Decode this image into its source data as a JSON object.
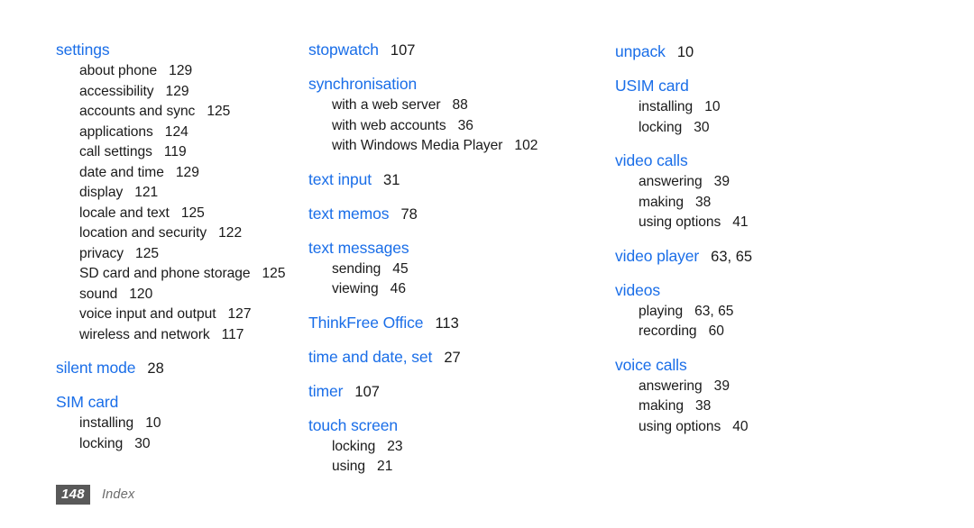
{
  "document": {
    "section_title": "Index",
    "page_number": "148",
    "heading_color": "#1a6ee8",
    "text_color": "#1a1a1a",
    "badge_color": "#595959",
    "background_color": "#ffffff"
  },
  "columns": [
    {
      "name": "column-1",
      "groups": [
        {
          "heading": "settings",
          "pages": "",
          "subentries": [
            {
              "label": "about phone",
              "pages": "129"
            },
            {
              "label": "accessibility",
              "pages": "129"
            },
            {
              "label": "accounts and sync",
              "pages": "125"
            },
            {
              "label": "applications",
              "pages": "124"
            },
            {
              "label": "call settings",
              "pages": "119"
            },
            {
              "label": "date and time",
              "pages": "129"
            },
            {
              "label": "display",
              "pages": "121"
            },
            {
              "label": "locale and text",
              "pages": "125"
            },
            {
              "label": "location and security",
              "pages": "122"
            },
            {
              "label": "privacy",
              "pages": "125"
            },
            {
              "label": "SD card and phone storage",
              "pages": "125"
            },
            {
              "label": "sound",
              "pages": "120"
            },
            {
              "label": "voice input and output",
              "pages": "127"
            },
            {
              "label": "wireless and network",
              "pages": "117"
            }
          ]
        },
        {
          "heading": "silent mode",
          "pages": "28",
          "subentries": []
        },
        {
          "heading": "SIM card",
          "pages": "",
          "subentries": [
            {
              "label": "installing",
              "pages": "10"
            },
            {
              "label": "locking",
              "pages": "30"
            }
          ]
        }
      ]
    },
    {
      "name": "column-2",
      "groups": [
        {
          "heading": "stopwatch",
          "pages": "107",
          "subentries": []
        },
        {
          "heading": "synchronisation",
          "pages": "",
          "subentries": [
            {
              "label": "with a web server",
              "pages": "88"
            },
            {
              "label": "with web accounts",
              "pages": "36"
            },
            {
              "label": "with Windows Media Player",
              "pages": "102"
            }
          ]
        },
        {
          "heading": "text input",
          "pages": "31",
          "subentries": []
        },
        {
          "heading": "text memos",
          "pages": "78",
          "subentries": []
        },
        {
          "heading": "text messages",
          "pages": "",
          "subentries": [
            {
              "label": "sending",
              "pages": "45"
            },
            {
              "label": "viewing",
              "pages": "46"
            }
          ]
        },
        {
          "heading": "ThinkFree Office",
          "pages": "113",
          "subentries": []
        },
        {
          "heading": "time and date, set",
          "pages": "27",
          "subentries": []
        },
        {
          "heading": "timer",
          "pages": "107",
          "subentries": []
        },
        {
          "heading": "touch screen",
          "pages": "",
          "subentries": [
            {
              "label": "locking",
              "pages": "23"
            },
            {
              "label": "using",
              "pages": "21"
            }
          ]
        }
      ]
    },
    {
      "name": "column-3",
      "groups": [
        {
          "heading": "unpack",
          "pages": "10",
          "subentries": []
        },
        {
          "heading": "USIM card",
          "pages": "",
          "subentries": [
            {
              "label": "installing",
              "pages": "10"
            },
            {
              "label": "locking",
              "pages": "30"
            }
          ]
        },
        {
          "heading": "video calls",
          "pages": "",
          "subentries": [
            {
              "label": "answering",
              "pages": "39"
            },
            {
              "label": "making",
              "pages": "38"
            },
            {
              "label": "using options",
              "pages": "41"
            }
          ]
        },
        {
          "heading": "video player",
          "pages": "63, 65",
          "subentries": []
        },
        {
          "heading": "videos",
          "pages": "",
          "subentries": [
            {
              "label": "playing",
              "pages": "63, 65"
            },
            {
              "label": "recording",
              "pages": "60"
            }
          ]
        },
        {
          "heading": "voice calls",
          "pages": "",
          "subentries": [
            {
              "label": "answering",
              "pages": "39"
            },
            {
              "label": "making",
              "pages": "38"
            },
            {
              "label": "using options",
              "pages": "40"
            }
          ]
        }
      ]
    }
  ]
}
